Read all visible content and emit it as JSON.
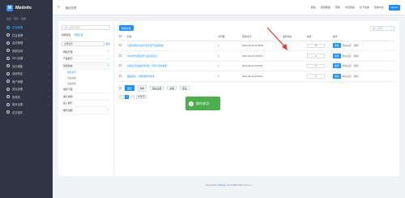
{
  "app": {
    "logo_letter": "M",
    "logo_text": "Metinfo"
  },
  "sidebar": {
    "links": [
      "后台",
      "首页",
      "后端"
    ],
    "items": [
      {
        "label": "内容管理",
        "active": true
      },
      {
        "label": "栏目管理"
      },
      {
        "label": "会员管理"
      },
      {
        "label": "营销活动"
      },
      {
        "label": "SEO设置"
      },
      {
        "label": "站点模板"
      },
      {
        "label": "应用商店"
      },
      {
        "label": "用户管理"
      },
      {
        "label": "安全设置"
      },
      {
        "label": "多语言"
      },
      {
        "label": "基本设置"
      },
      {
        "label": "企业插件"
      }
    ]
  },
  "topbar": {
    "title": "模块文章",
    "actions": [
      "网站",
      "使用教程",
      "帮助",
      "访问网站",
      "关于系统",
      "简体中文"
    ],
    "user": "admin"
  },
  "left_panel": {
    "search_placeholder": "输入关键词搜索",
    "add_category": "新增栏目",
    "manage_category": "管理栏目",
    "select_value": "全部显示",
    "refresh": "更新",
    "categories": [
      {
        "label": "网站开发",
        "caret": true
      },
      {
        "label": "产品展示",
        "caret": true
      },
      {
        "label": "新闻动态",
        "caret": true,
        "group": true
      }
    ],
    "subs": [
      {
        "label": "新闻资讯",
        "active": true
      },
      {
        "label": "行业动态"
      },
      {
        "label": "企业新闻"
      }
    ],
    "more": [
      {
        "label": "资料下载"
      },
      {
        "label": "客户案例"
      },
      {
        "label": "加入我们"
      },
      {
        "label": "服务功能",
        "caret": true
      }
    ]
  },
  "toolbar": {
    "add_label": "新增文章",
    "keyword_placeholder": "输入关键词"
  },
  "table": {
    "headers": [
      "",
      "标题",
      "访问量",
      "更新时间",
      "发布状态",
      "排序",
      "操作"
    ],
    "rows": [
      {
        "title": "智能家居的全屋智慧家居产品的研发",
        "views": "1",
        "time": "2023-03-26 15:05:56",
        "status": "待审",
        "sort": "0"
      },
      {
        "title": "2020年智能家居行业迎来春天",
        "views": "1",
        "time": "2021-09-11 16:59:51",
        "status": "",
        "sort": "0"
      },
      {
        "title": "健康生活自由智慧科技 \"手机引领新未来\"",
        "views": "1",
        "time": "2021-09-11 16:59:51",
        "status": "",
        "sort": "0"
      },
      {
        "title": "做品质家，用体验影响未来",
        "views": "1",
        "time": "2021-09-11 16:59:51",
        "status": "",
        "sort": "0"
      }
    ],
    "op_edit": "编辑",
    "op_links": [
      "移动设置",
      "删除"
    ]
  },
  "bulk": {
    "save": "保存",
    "delete": "删除",
    "move": "移动设置",
    "copy": "复制",
    "more": "更多"
  },
  "pager": {
    "prev": "<",
    "pages": [
      "1"
    ],
    "current": "1",
    "next": ">",
    "pagesize": "10条/页"
  },
  "toast": {
    "text": "操作成功"
  },
  "footer": {
    "prefix": "Powered by",
    "brand": "MetInfo 7.8",
    "suffix": "©2008-2023 mituo.cn"
  },
  "colors": {
    "accent": "#1e90ff",
    "sidebar_bg": "#2f3542",
    "toast": "#4cae4c",
    "annotation_arrow": "#e53935"
  }
}
